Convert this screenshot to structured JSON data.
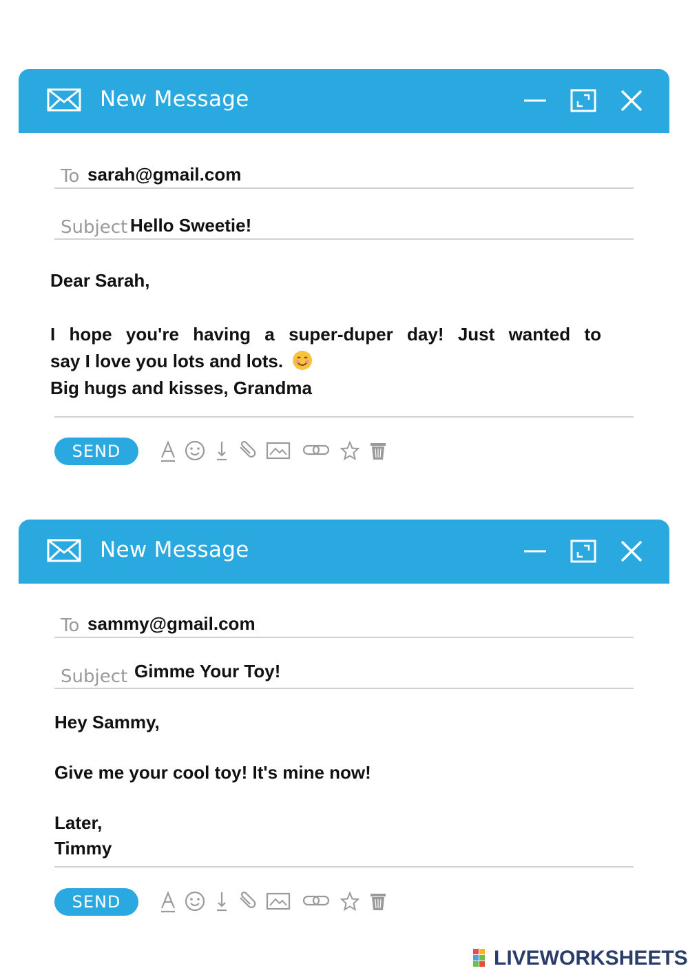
{
  "windows": [
    {
      "title": "New Message",
      "to_label": "To",
      "to_value": "sarah@gmail.com",
      "subject_label": "Subject",
      "subject_value": "Hello Sweetie!",
      "body": {
        "greeting": "Dear Sarah,",
        "line1": "I hope you're having a super-duper day! Just wanted to",
        "line2": "say I love you lots and lots.",
        "line3": "Big hugs and kisses, Grandma"
      },
      "send_label": "SEND"
    },
    {
      "title": "New Message",
      "to_label": "To",
      "to_value": "sammy@gmail.com",
      "subject_label": "Subject",
      "subject_value": "Gimme Your Toy!",
      "body": {
        "greeting": "Hey Sammy,",
        "line1": "Give me your cool toy! It's mine now!",
        "line2": "Later,",
        "line3": "Timmy"
      },
      "send_label": "SEND"
    }
  ],
  "toolbar_icons": [
    "text-format-icon",
    "emoji-icon",
    "download-icon",
    "attachment-icon",
    "image-icon",
    "link-icon",
    "star-icon",
    "trash-icon"
  ],
  "logo": {
    "text": "LIVEWORKSHEETS"
  },
  "colors": {
    "accent": "#2aa8e0",
    "text": "#111111",
    "label": "#9a9a9a",
    "line": "#d0d0d0"
  }
}
